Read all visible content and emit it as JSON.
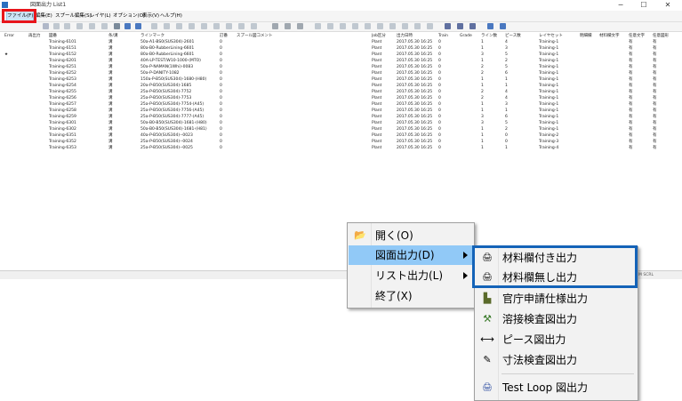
{
  "window": {
    "title": "図面出力 List1",
    "minimize": "─",
    "maximize": "☐",
    "close": "✕"
  },
  "menubar": [
    {
      "label": "ファイル(F)"
    },
    {
      "label": "編集(E)"
    },
    {
      "label": "スプール編集(S)"
    },
    {
      "label": "レイヤ(L)"
    },
    {
      "label": "オプション(O)"
    },
    {
      "label": "表示(V)"
    },
    {
      "label": "ヘルプ(H)"
    }
  ],
  "table": {
    "headers": [
      "Error",
      "再出力",
      "図番",
      "条/溝",
      "ラインマーク",
      "訂番",
      "スプール図コメント",
      "Job区分",
      "出力日時",
      "Train",
      "Grade",
      "ライン数",
      "ピース数",
      "レイヤセット",
      "明細欄",
      "材料欄文字",
      "任意文字",
      "任意図形"
    ],
    "rows": [
      [
        "",
        "",
        "Training-6101",
        "溝",
        "50a-A1-BS0(SUS304)-2601",
        "0",
        "",
        "Plant",
        "2017.05.30 16:25",
        "0",
        "",
        "1",
        "4",
        "Training-1",
        "",
        "",
        "有",
        "有"
      ],
      [
        "",
        "",
        "Training-6151",
        "溝",
        "80a-B0-RubberLining-6601",
        "0",
        "",
        "Plant",
        "2017.05.30 16:25",
        "0",
        "",
        "1",
        "3",
        "Training-1",
        "",
        "",
        "有",
        "有"
      ],
      [
        "★",
        "",
        "Training-6152",
        "溝",
        "80a-B0-RubberLining-6601",
        "0",
        "",
        "Plant",
        "2017.05.30 16:25",
        "0",
        "",
        "3",
        "5",
        "Training-1",
        "",
        "",
        "有",
        "有"
      ],
      [
        "",
        "",
        "Training-6201",
        "溝",
        "40A-LP-TEST/W10-1000-(MTO)",
        "0",
        "",
        "Plant",
        "2017.05.30 16:25",
        "0",
        "",
        "1",
        "2",
        "Training-1",
        "",
        "",
        "有",
        "有"
      ],
      [
        "",
        "",
        "Training-6251",
        "溝",
        "50a-P-NAMAN(1Whi)-0083",
        "0",
        "",
        "Plant",
        "2017.05.30 16:25",
        "0",
        "",
        "2",
        "5",
        "Training-1",
        "",
        "",
        "有",
        "有"
      ],
      [
        "",
        "",
        "Training-6252",
        "溝",
        "50a-P-DANITY-1082",
        "0",
        "",
        "Plant",
        "2017.05.30 16:25",
        "0",
        "",
        "2",
        "6",
        "Training-1",
        "",
        "",
        "有",
        "有"
      ],
      [
        "",
        "",
        "Training-6253",
        "溝",
        "150a-P-B50(SUS304)-1680-(H80)",
        "0",
        "",
        "Plant",
        "2017.05.30 16:25",
        "0",
        "",
        "1",
        "1",
        "Training-1",
        "",
        "",
        "有",
        "有"
      ],
      [
        "",
        "",
        "Training-6254",
        "溝",
        "20a-P-B50(SUS304)-1685",
        "0",
        "",
        "Plant",
        "2017.05.30 16:25",
        "0",
        "",
        "1",
        "1",
        "Training-1",
        "",
        "",
        "有",
        "有"
      ],
      [
        "",
        "",
        "Training-6255",
        "溝",
        "25a-P-B50(SUS304)-7752",
        "0",
        "",
        "Plant",
        "2017.05.30 16:25",
        "0",
        "",
        "2",
        "4",
        "Training-1",
        "",
        "",
        "有",
        "有"
      ],
      [
        "",
        "",
        "Training-6256",
        "溝",
        "25a-P-B50(SUS304)-7753",
        "0",
        "",
        "Plant",
        "2017.05.30 16:25",
        "0",
        "",
        "2",
        "4",
        "Training-1",
        "",
        "",
        "有",
        "有"
      ],
      [
        "",
        "",
        "Training-6257",
        "溝",
        "25a-P-B50(SUS304)-7754-(A45)",
        "0",
        "",
        "Plant",
        "2017.05.30 16:25",
        "0",
        "",
        "1",
        "3",
        "Training-1",
        "",
        "",
        "有",
        "有"
      ],
      [
        "",
        "",
        "Training-6258",
        "溝",
        "25a-P-B50(SUS304)-7756-(A45)",
        "0",
        "",
        "Plant",
        "2017.05.30 16:25",
        "0",
        "",
        "1",
        "1",
        "Training-1",
        "",
        "",
        "有",
        "有"
      ],
      [
        "",
        "",
        "Training-6259",
        "溝",
        "25a-P-B50(SUS304)-7777-(A45)",
        "0",
        "",
        "Plant",
        "2017.05.30 16:25",
        "0",
        "",
        "3",
        "6",
        "Training-1",
        "",
        "",
        "有",
        "有"
      ],
      [
        "",
        "",
        "Training-6301",
        "溝",
        "50a-B0-B50(SUS304)-1681-(H80)",
        "0",
        "",
        "Plant",
        "2017.05.30 16:25",
        "0",
        "",
        "3",
        "5",
        "Training-1",
        "",
        "",
        "有",
        "有"
      ],
      [
        "",
        "",
        "Training-6302",
        "溝",
        "50a-B0-B50(SUS304)-1681-(H81)",
        "0",
        "",
        "Plant",
        "2017.05.30 16:25",
        "0",
        "",
        "1",
        "2",
        "Training-1",
        "",
        "",
        "有",
        "有"
      ],
      [
        "",
        "",
        "Training-6351",
        "溝",
        "40a-P-B50(SUS304)--0023",
        "0",
        "",
        "Plant",
        "2017.05.30 16:25",
        "0",
        "",
        "1",
        "0",
        "Training-2",
        "",
        "",
        "有",
        "有"
      ],
      [
        "",
        "",
        "Training-6352",
        "溝",
        "25a-P-B50(SUS304)--0024",
        "0",
        "",
        "Plant",
        "2017.05.30 16:25",
        "0",
        "",
        "1",
        "0",
        "Training-3",
        "",
        "",
        "有",
        "有"
      ],
      [
        "",
        "",
        "Training-6353",
        "溝",
        "25a-P-B50(SUS304)--0025",
        "0",
        "",
        "Plant",
        "2017.05.30 16:25",
        "0",
        "",
        "1",
        "1",
        "Training-4",
        "",
        "",
        "有",
        "有"
      ]
    ]
  },
  "statusbar": {
    "text": "CAP NUM SCRL"
  },
  "file_menu": {
    "items": [
      {
        "label": "開く(O)",
        "icon": "open-folder-icon",
        "submenu": false
      },
      {
        "label": "図面出力(D)",
        "icon": "",
        "submenu": true
      },
      {
        "label": "リスト出力(L)",
        "icon": "",
        "submenu": true
      },
      {
        "label": "終了(X)",
        "icon": "",
        "submenu": false
      }
    ]
  },
  "drawing_submenu": {
    "items": [
      {
        "label": "材料欄付き出力",
        "icon": "print-with-material-icon"
      },
      {
        "label": "材料欄無し出力",
        "icon": "print-without-material-icon"
      },
      {
        "label": "官庁申請仕様出力",
        "icon": "building-print-icon"
      },
      {
        "label": "溶接検査図出力",
        "icon": "weld-inspection-icon"
      },
      {
        "label": "ピース図出力",
        "icon": "piece-drawing-icon"
      },
      {
        "label": "寸法検査図出力",
        "icon": "dimension-inspection-icon"
      },
      {
        "label": "Test Loop 図出力",
        "icon": "test-loop-icon"
      }
    ]
  },
  "colors": {
    "highlight": "#91c9f7",
    "red_annotation": "#e8151b",
    "blue_annotation": "#1463b8"
  }
}
